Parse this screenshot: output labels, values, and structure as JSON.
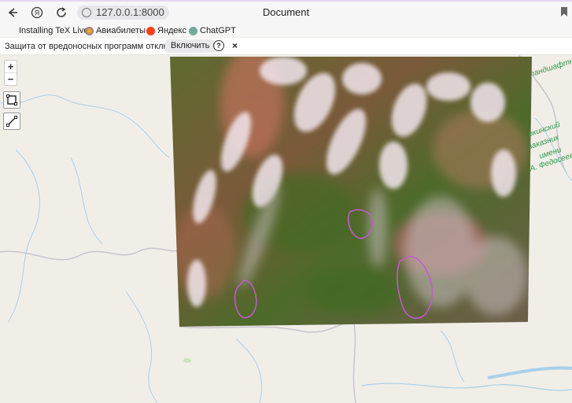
{
  "browser": {
    "url": "127.0.0.1:8000",
    "title": "Document",
    "icons": [
      "back-arrow-icon",
      "yandex-logo-icon",
      "reload-icon",
      "globe-icon",
      "bookmark-icon"
    ]
  },
  "bookmarks": [
    {
      "label": "Installing TeX Live"
    },
    {
      "label": "Авиабилеты"
    },
    {
      "label": "Яндекс"
    },
    {
      "label": "ChatGPT"
    }
  ],
  "infobar": {
    "message": "Защита от вредоносных программ отключена",
    "enable_label": "Включить",
    "help_label": "?",
    "close_label": "×"
  },
  "map": {
    "zoom_in": "+",
    "zoom_out": "−",
    "labels": [
      "ландшафтный",
      "окинский",
      "заказник",
      "имени",
      "А. Федосеев"
    ]
  },
  "colors": {
    "fire_outline": "#c25bd0",
    "label_green": "#2e9b4a",
    "river": "#9ecae8"
  }
}
